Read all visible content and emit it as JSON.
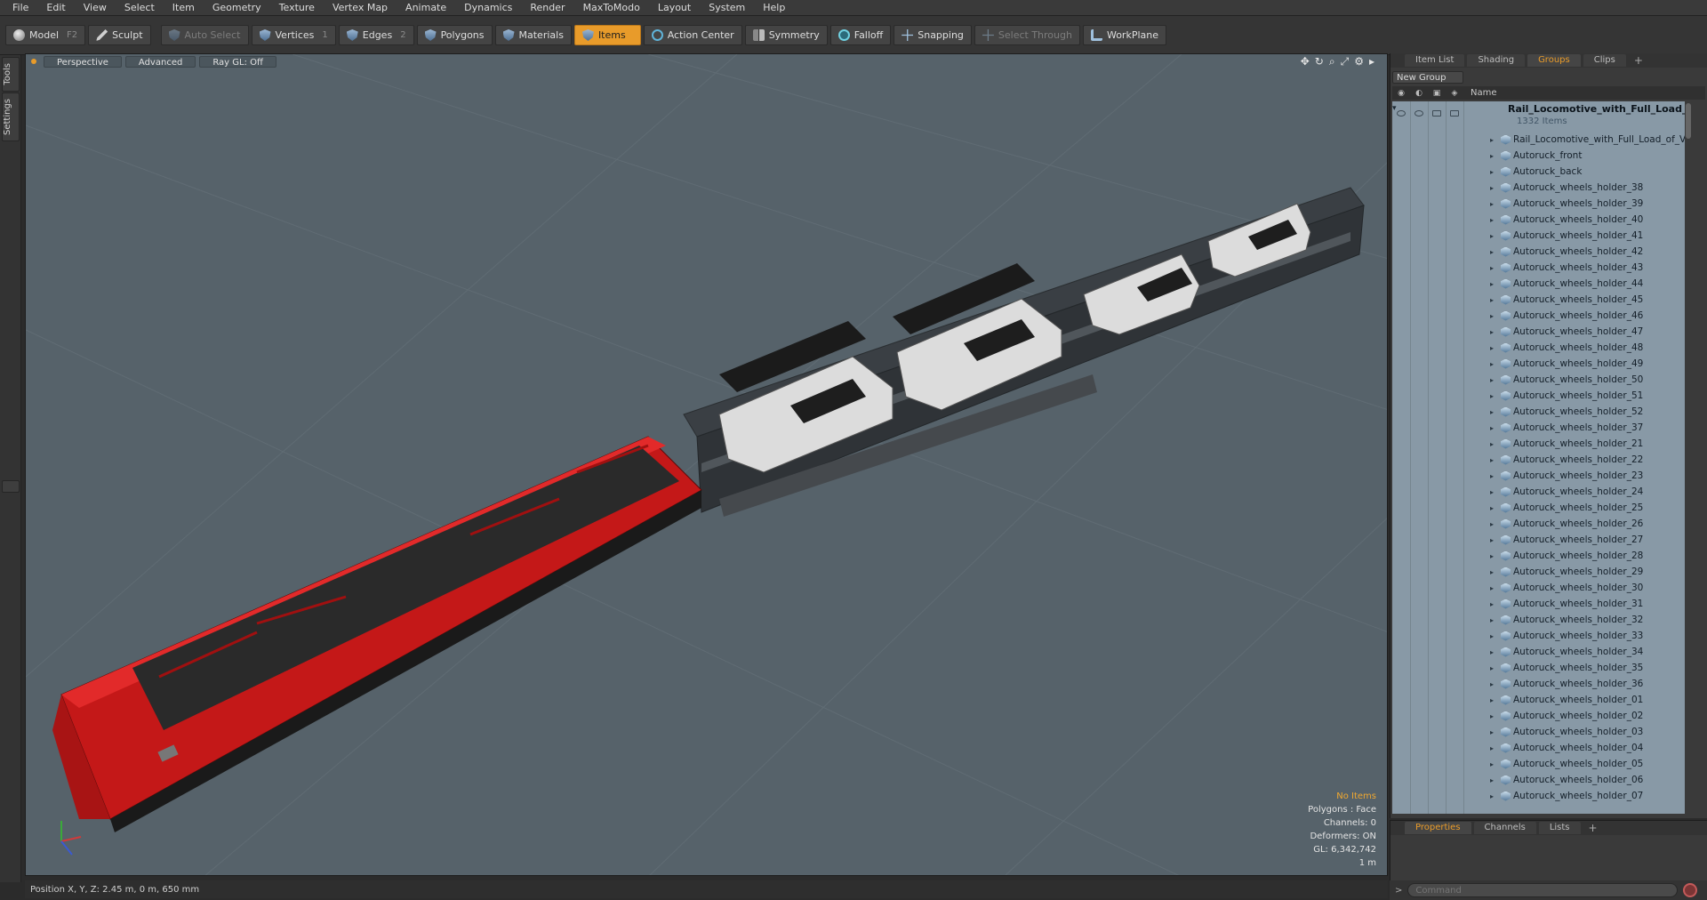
{
  "menu": [
    "File",
    "Edit",
    "View",
    "Select",
    "Item",
    "Geometry",
    "Texture",
    "Vertex Map",
    "Animate",
    "Dynamics",
    "Render",
    "MaxToModo",
    "Layout",
    "System",
    "Help"
  ],
  "toolbar": {
    "model": "Model",
    "model_key": "F2",
    "sculpt": "Sculpt",
    "auto_select": "Auto Select",
    "vertices": "Vertices",
    "vertices_key": "1",
    "edges": "Edges",
    "edges_key": "2",
    "polygons": "Polygons",
    "materials": "Materials",
    "items": "Items",
    "action_center": "Action Center",
    "symmetry": "Symmetry",
    "falloff": "Falloff",
    "snapping": "Snapping",
    "select_through": "Select Through",
    "workplane": "WorkPlane"
  },
  "left_tabs": [
    "Tools",
    "Settings"
  ],
  "viewport": {
    "view": "Perspective",
    "mode": "Advanced",
    "raygl": "Ray GL: Off",
    "info": [
      "No Items",
      "Polygons : Face",
      "Channels: 0",
      "Deformers: ON",
      "GL: 6,342,742",
      "1 m"
    ],
    "accent": "#e89b2a",
    "background": "#56626a"
  },
  "status": "Position X, Y, Z:   2.45 m, 0 m, 650 mm",
  "right_tabs": [
    "Item List",
    "Shading",
    "Groups",
    "Clips"
  ],
  "active_right_tab": "Groups",
  "new_group": "New Group",
  "columns": {
    "name": "Name"
  },
  "groups": {
    "root_name": "Rail_Locomotive_with_Full_Load_...",
    "root_count": "1332 Items",
    "items": [
      "Rail_Locomotive_with_Full_Load_of_V...",
      "Autoruck_front",
      "Autoruck_back",
      "Autoruck_wheels_holder_38",
      "Autoruck_wheels_holder_39",
      "Autoruck_wheels_holder_40",
      "Autoruck_wheels_holder_41",
      "Autoruck_wheels_holder_42",
      "Autoruck_wheels_holder_43",
      "Autoruck_wheels_holder_44",
      "Autoruck_wheels_holder_45",
      "Autoruck_wheels_holder_46",
      "Autoruck_wheels_holder_47",
      "Autoruck_wheels_holder_48",
      "Autoruck_wheels_holder_49",
      "Autoruck_wheels_holder_50",
      "Autoruck_wheels_holder_51",
      "Autoruck_wheels_holder_52",
      "Autoruck_wheels_holder_37",
      "Autoruck_wheels_holder_21",
      "Autoruck_wheels_holder_22",
      "Autoruck_wheels_holder_23",
      "Autoruck_wheels_holder_24",
      "Autoruck_wheels_holder_25",
      "Autoruck_wheels_holder_26",
      "Autoruck_wheels_holder_27",
      "Autoruck_wheels_holder_28",
      "Autoruck_wheels_holder_29",
      "Autoruck_wheels_holder_30",
      "Autoruck_wheels_holder_31",
      "Autoruck_wheels_holder_32",
      "Autoruck_wheels_holder_33",
      "Autoruck_wheels_holder_34",
      "Autoruck_wheels_holder_35",
      "Autoruck_wheels_holder_36",
      "Autoruck_wheels_holder_01",
      "Autoruck_wheels_holder_02",
      "Autoruck_wheels_holder_03",
      "Autoruck_wheels_holder_04",
      "Autoruck_wheels_holder_05",
      "Autoruck_wheels_holder_06",
      "Autoruck_wheels_holder_07"
    ]
  },
  "bottom_tabs": [
    "Properties",
    "Channels",
    "Lists"
  ],
  "active_bottom_tab": "Properties",
  "command_placeholder": "Command"
}
